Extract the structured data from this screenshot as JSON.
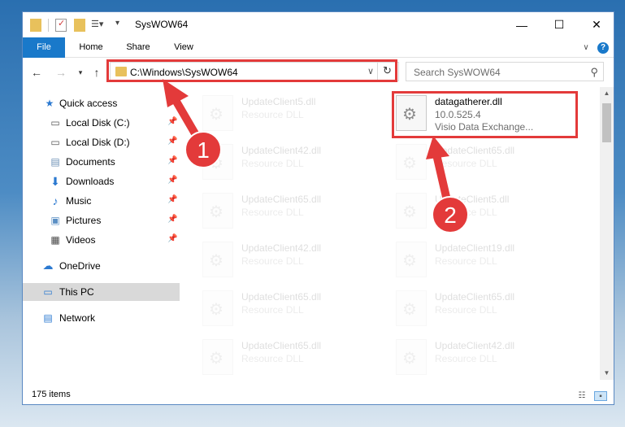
{
  "window": {
    "title": "SysWOW64"
  },
  "ribbon": {
    "tabs": [
      "File",
      "Home",
      "Share",
      "View"
    ]
  },
  "address": {
    "path": "C:\\Windows\\SysWOW64"
  },
  "search": {
    "placeholder": "Search SysWOW64"
  },
  "sidebar": {
    "quick_access": "Quick access",
    "items": [
      {
        "label": "Local Disk (C:)"
      },
      {
        "label": "Local Disk (D:)"
      },
      {
        "label": "Documents"
      },
      {
        "label": "Downloads"
      },
      {
        "label": "Music"
      },
      {
        "label": "Pictures"
      },
      {
        "label": "Videos"
      }
    ],
    "onedrive": "OneDrive",
    "thispc": "This PC",
    "network": "Network"
  },
  "files": [
    {
      "name": "UpdateClient5.dll",
      "desc": "Resource DLL"
    },
    {
      "name": "datagatherer.dll",
      "desc": "10.0.525.4",
      "desc2": "Visio Data Exchange..."
    },
    {
      "name": "UpdateClient42.dll",
      "desc": "Resource DLL"
    },
    {
      "name": "UpdateClient65.dll",
      "desc": "Resource DLL"
    },
    {
      "name": "UpdateClient65.dll",
      "desc": "Resource DLL"
    },
    {
      "name": "UpdateClient5.dll",
      "desc": "Resource DLL"
    },
    {
      "name": "UpdateClient42.dll",
      "desc": "Resource DLL"
    },
    {
      "name": "UpdateClient19.dll",
      "desc": "Resource DLL"
    },
    {
      "name": "UpdateClient65.dll",
      "desc": "Resource DLL"
    },
    {
      "name": "UpdateClient65.dll",
      "desc": "Resource DLL"
    },
    {
      "name": "UpdateClient65.dll",
      "desc": "Resource DLL"
    },
    {
      "name": "UpdateClient42.dll",
      "desc": "Resource DLL"
    }
  ],
  "status": {
    "count": "175 items"
  },
  "annotations": {
    "step1": "1",
    "step2": "2"
  },
  "colors": {
    "accent": "#1979ca",
    "highlight": "#e33a3a"
  }
}
